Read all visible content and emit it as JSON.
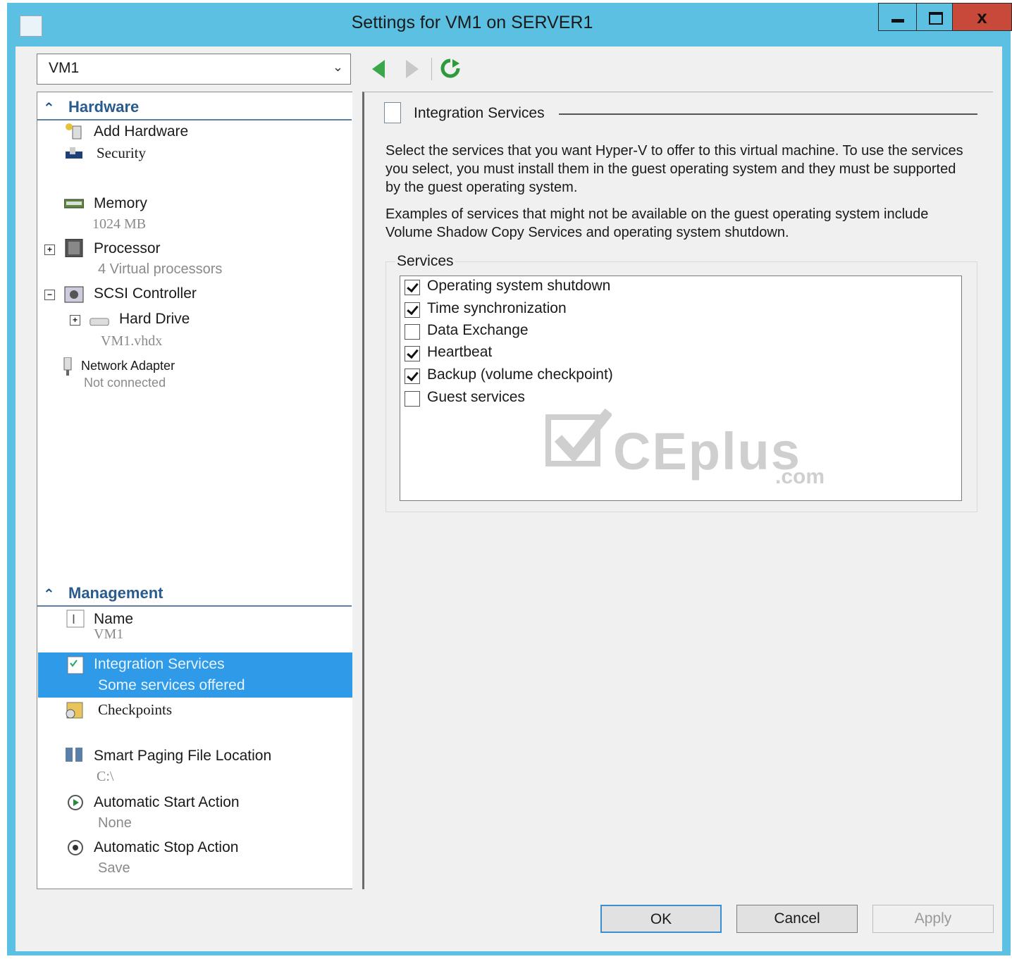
{
  "window": {
    "title": "Settings for VM1 on SERVER1",
    "close_glyph": "x"
  },
  "vm_selector": {
    "value": "VM1"
  },
  "tree": {
    "hardware_header": "Hardware",
    "management_header": "Management",
    "items": {
      "add_hardware": {
        "label": "Add Hardware"
      },
      "security": {
        "label": "Security"
      },
      "memory": {
        "label": "Memory",
        "sub": "1024  MB"
      },
      "processor": {
        "label": "Processor",
        "sub": "4 Virtual processors"
      },
      "scsi": {
        "label": "SCSI Controller"
      },
      "hard_drive": {
        "label": "Hard Drive",
        "sub": "VM1.vhdx"
      },
      "network": {
        "label": "Network Adapter",
        "sub": "Not connected"
      },
      "name": {
        "label": "Name",
        "sub": "VM1"
      },
      "integration": {
        "label": "Integration Services",
        "sub": "Some services offered"
      },
      "checkpoints": {
        "label": "Checkpoints"
      },
      "smart_paging": {
        "label": "Smart Paging File Location",
        "sub": "C:\\"
      },
      "auto_start": {
        "label": "Automatic Start Action",
        "sub": "None"
      },
      "auto_stop": {
        "label": "Automatic Stop Action",
        "sub": "Save"
      }
    }
  },
  "detail": {
    "title": "Integration Services",
    "para1": "Select the services that you want Hyper-V to offer to this virtual machine. To use the services you select, you must install them in the guest operating system and they must be supported by the guest operating system.",
    "para2": "Examples of services that might not be available on the guest operating system include Volume Shadow Copy Services and operating system shutdown.",
    "services_label": "Services",
    "services": [
      {
        "label": "Operating system shutdown",
        "checked": true
      },
      {
        "label": "Time synchronization",
        "checked": true
      },
      {
        "label": "Data Exchange",
        "checked": false
      },
      {
        "label": "Heartbeat",
        "checked": true
      },
      {
        "label": "Backup (volume checkpoint)",
        "checked": true
      },
      {
        "label": "Guest services",
        "checked": false
      }
    ]
  },
  "watermark": {
    "text": "CEplus",
    "suffix": ".com"
  },
  "buttons": {
    "ok": "OK",
    "cancel": "Cancel",
    "apply": "Apply"
  },
  "colors": {
    "accent": "#2f9ae8",
    "frame": "#5bc0e2",
    "close": "#c8483a"
  }
}
